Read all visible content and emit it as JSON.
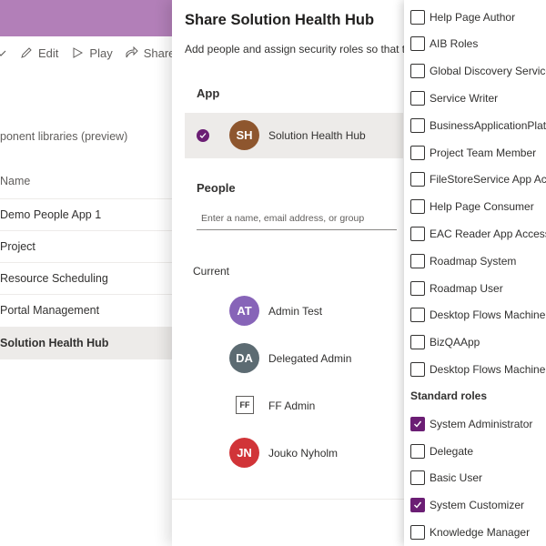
{
  "background_app": {
    "commands": [
      {
        "label": "Edit",
        "icon": "edit-icon"
      },
      {
        "label": "Play",
        "icon": "play-icon"
      },
      {
        "label": "Share",
        "icon": "share-icon"
      }
    ],
    "breadcrumb": "ponent libraries (preview)",
    "column_header": "Name",
    "rows": [
      {
        "label": "Demo People App 1"
      },
      {
        "label": "Project"
      },
      {
        "label": "Resource Scheduling"
      },
      {
        "label": "Portal Management"
      },
      {
        "label": "Solution Health Hub",
        "selected": true
      }
    ]
  },
  "share_panel": {
    "title": "Share Solution Health Hub",
    "description": "Add people and assign security roles so that the",
    "app_section_label": "App",
    "app": {
      "initials": "SH",
      "name": "Solution Health Hub",
      "avatar_color": "#8e562e",
      "selected": true
    },
    "people_label": "People",
    "people_placeholder": "Enter a name, email address, or group",
    "current_label": "Current",
    "current_users": [
      {
        "initials": "AT",
        "name": "Admin Test",
        "avatar_color": "#8764b8"
      },
      {
        "initials": "DA",
        "name": "Delegated Admin",
        "avatar_color": "#5c6b72"
      },
      {
        "initials": "FF",
        "name": "FF Admin",
        "avatar_color": "",
        "icon": "ff-logo-icon"
      },
      {
        "initials": "JN",
        "name": "Jouko Nyholm",
        "avatar_color": "#d13438"
      }
    ]
  },
  "roles_dropdown": {
    "custom_roles": [
      {
        "label": "Help Page Author",
        "checked": false
      },
      {
        "label": "AIB Roles",
        "checked": false
      },
      {
        "label": "Global Discovery Service I",
        "checked": false
      },
      {
        "label": "Service Writer",
        "checked": false
      },
      {
        "label": "BusinessApplicationPlatfo",
        "checked": false
      },
      {
        "label": "Project Team Member",
        "checked": false
      },
      {
        "label": "FileStoreService App Acce",
        "checked": false
      },
      {
        "label": "Help Page Consumer",
        "checked": false
      },
      {
        "label": "EAC Reader App Access",
        "checked": false
      },
      {
        "label": "Roadmap System",
        "checked": false
      },
      {
        "label": "Roadmap User",
        "checked": false
      },
      {
        "label": "Desktop Flows Machine C",
        "checked": false
      },
      {
        "label": "BizQAApp",
        "checked": false
      },
      {
        "label": "Desktop Flows Machine U",
        "checked": false
      }
    ],
    "standard_header": "Standard roles",
    "standard_roles": [
      {
        "label": "System Administrator",
        "checked": true
      },
      {
        "label": "Delegate",
        "checked": false
      },
      {
        "label": "Basic User",
        "checked": false
      },
      {
        "label": "System Customizer",
        "checked": true
      },
      {
        "label": "Knowledge Manager",
        "checked": false
      }
    ]
  },
  "colors": {
    "accent": "#6b1e74",
    "topbar": "#b27fb8"
  }
}
